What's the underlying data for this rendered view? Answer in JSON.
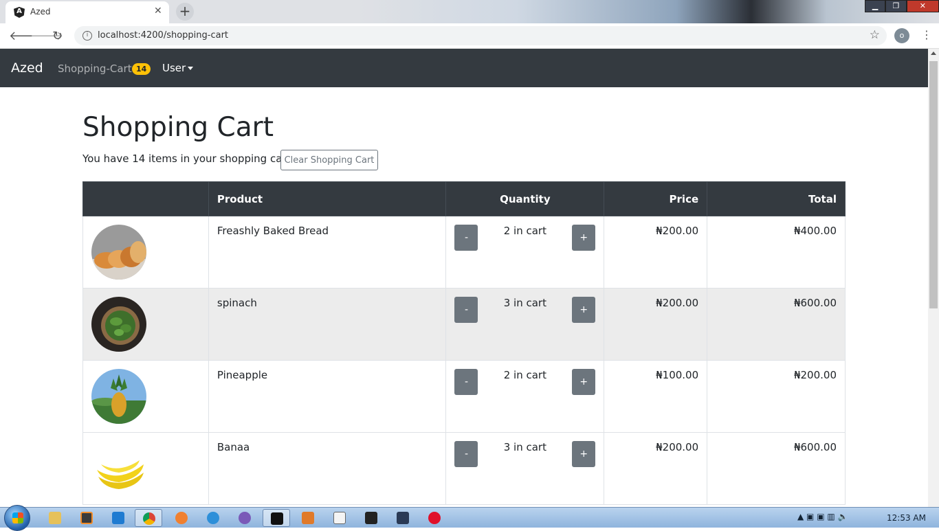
{
  "browser": {
    "tab_title": "Azed",
    "tab_favicon": "A",
    "close_glyph": "✕",
    "new_tab_glyph": "+",
    "url": "localhost:4200/shopping-cart",
    "profile_initial": "o",
    "window_controls": [
      "▁",
      "❐",
      "✕"
    ]
  },
  "navbar": {
    "brand": "Azed",
    "cart_link": "Shopping-Cart",
    "cart_count": "14",
    "user_menu": "User"
  },
  "page": {
    "heading": "Shopping Cart",
    "summary": "You have 14 items in your shopping cart",
    "clear_button": "Clear Shopping Cart"
  },
  "table": {
    "headers": [
      "",
      "Product",
      "Quantity",
      "Price",
      "Total"
    ],
    "rows": [
      {
        "product": "Freashly Baked Bread",
        "quantity": "2 in cart",
        "price": "₦200.00",
        "total": "₦400.00",
        "image": "bread-image"
      },
      {
        "product": "spinach",
        "quantity": "3 in cart",
        "price": "₦200.00",
        "total": "₦600.00",
        "image": "spinach-image"
      },
      {
        "product": "Pineapple",
        "quantity": "2 in cart",
        "price": "₦100.00",
        "total": "₦200.00",
        "image": "pineapple-image"
      },
      {
        "product": "Banaa",
        "quantity": "3 in cart",
        "price": "₦200.00",
        "total": "₦600.00",
        "image": "banana-image"
      }
    ],
    "minus_label": "-",
    "plus_label": "+"
  },
  "taskbar": {
    "clock": "12:53 AM",
    "items": [
      "explorer",
      "sublime",
      "chrome",
      "app-orange",
      "ie",
      "app-purple",
      "cmd",
      "app-box",
      "app-window",
      "powershell",
      "app-dark",
      "opera"
    ]
  }
}
